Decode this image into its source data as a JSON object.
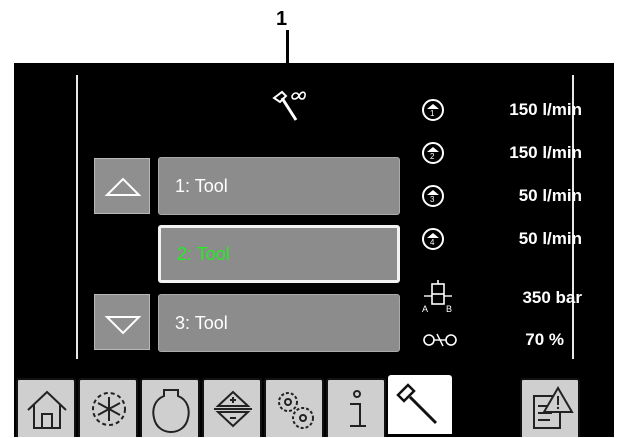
{
  "callout": {
    "number": "1"
  },
  "tools": {
    "list": [
      {
        "label": "1: Tool",
        "selected": false
      },
      {
        "label": "2: Tool",
        "selected": true
      },
      {
        "label": "3: Tool",
        "selected": false
      }
    ],
    "selected_color": "#22ee22"
  },
  "flows": [
    {
      "circuit": "1",
      "value": "150 l/min"
    },
    {
      "circuit": "2",
      "value": "150 l/min"
    },
    {
      "circuit": "3",
      "value": "50 l/min"
    },
    {
      "circuit": "4",
      "value": "50 l/min"
    }
  ],
  "pressure": {
    "port_a": "A",
    "port_b": "B",
    "value": "350 bar"
  },
  "ratio": {
    "value": "70 %"
  },
  "icons": {
    "header": "hammer-infinity-icon",
    "up": "triangle-up-icon",
    "down": "triangle-down-icon",
    "tabs": [
      "home-icon",
      "snowflake-gear-icon",
      "tank-icon",
      "up-down-arrows-icon",
      "gears-icon",
      "info-icon",
      "hammer-icon",
      "warning-notes-icon"
    ]
  }
}
